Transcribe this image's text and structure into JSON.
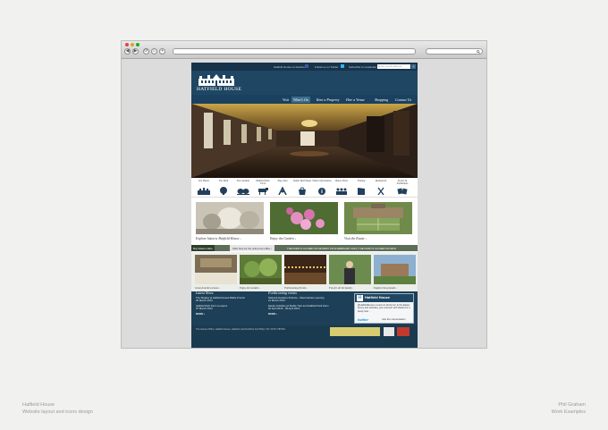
{
  "browser": {
    "nav_buttons": [
      "◀",
      "▶",
      "⟳",
      "⌂",
      "+"
    ],
    "traffic_light_colors": [
      "#e0443e",
      "#dea123",
      "#1aab29"
    ]
  },
  "site": {
    "topbar": {
      "facebook": "Hatfield House on Facebook",
      "twitter": "Follow us on Twitter",
      "newsletter": "Subscribe to newsletter",
      "email_placeholder": "Enter email address"
    },
    "logo_text": "HATFIELD HOUSE",
    "nav": [
      "Visit",
      "What's On",
      "Rent a Property",
      "Hire a Venue",
      "Shopping",
      "Contact Us"
    ],
    "nav_active": "What's On",
    "icons": [
      {
        "label": "The House",
        "icon": "house-icon"
      },
      {
        "label": "The Park",
        "icon": "tree-icon"
      },
      {
        "label": "The Gardens",
        "icon": "garden-icon"
      },
      {
        "label": "Hatfield Park Farm",
        "icon": "farm-animal-icon"
      },
      {
        "label": "Play Area",
        "icon": "playground-icon"
      },
      {
        "label": "Stable Yard Shops",
        "icon": "shop-icon"
      },
      {
        "label": "Visitor Information",
        "icon": "info-icon"
      },
      {
        "label": "House Visits",
        "icon": "group-icon"
      },
      {
        "label": "Filming",
        "icon": "clapperboard-icon"
      },
      {
        "label": "Restaurant",
        "icon": "cutlery-icon"
      },
      {
        "label": "Events & Exhibitions",
        "icon": "events-icon"
      }
    ],
    "features": [
      {
        "caption": "Explore historic Hatfield House ›"
      },
      {
        "caption": "Enjoy the Garden ›"
      },
      {
        "caption": "Visit the Estate ›"
      }
    ],
    "ticker": {
      "button": "Buy tickets online",
      "middle": "Click here for the online box office ›",
      "message": "THE PARK IS CLOSED ON MONDAY 19TH FEBRUARY 2013 | THE PARK IS CLOSED ON MON"
    },
    "thumbs": [
      {
        "caption": "Great function venues ›"
      },
      {
        "caption": "Enjoy the Garden ›"
      },
      {
        "caption": "Forthcoming Events ›"
      },
      {
        "caption": "Fun for all the family ›"
      },
      {
        "caption": "Explore the grounds ›"
      }
    ],
    "latest_news": {
      "title": "Latest News",
      "items": [
        {
          "text": "The Shades at Hatfield House Battle Proms!",
          "date": "20 March 2013"
        },
        {
          "text": "Hatfield Park Farm re-opens",
          "date": "07 March 2013"
        }
      ],
      "more": "MORE ›"
    },
    "events": {
      "title": "Forthcoming events",
      "items": [
        {
          "text": "National Gardens Scheme - West Garden opening",
          "date": "21 March 2013"
        },
        {
          "text": "Easter Activities at Stable Yard and Hatfield Park Farm",
          "date": "02 April 2013 - 05 April 2013"
        }
      ],
      "more": "MORE ›"
    },
    "twitter_widget": {
      "name": "Hatfield House",
      "handle": "Hatfield House",
      "tweet": "@HatfieldHouse Loved our family fun at the Easter bunny and activities, just a bonus! with thanks for a lovely visit ...",
      "link_label": "Join the conversation",
      "brand": "twitter"
    },
    "footer": {
      "address": "The House Office, Hatfield House, Hatfield, Hertfordshire AL9 5NQ  |  Tel: 01707 287010"
    },
    "colors": {
      "navy": "#1f4763",
      "dark_navy": "#17334a",
      "ticker_green": "#5c6d58"
    }
  },
  "page_captions": {
    "left_title": "Hatfield House",
    "left_sub": "Website layout and icons design",
    "right_title": "Phil Graham",
    "right_sub": "Work Examples"
  }
}
